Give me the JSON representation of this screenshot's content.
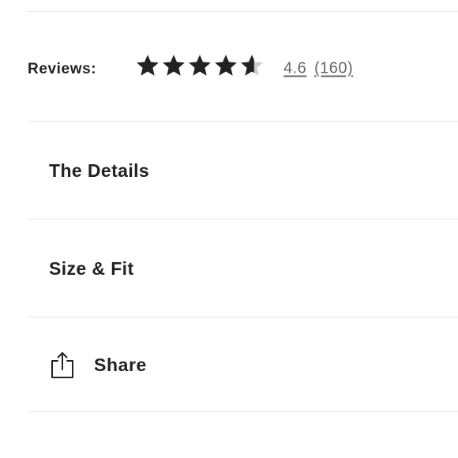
{
  "reviews": {
    "label": "Reviews:",
    "rating": "4.6",
    "rating_fraction_of_five": 0.92,
    "count": "(160)",
    "star_color": "#222222",
    "star_empty_color": "#cccccc"
  },
  "sections": {
    "details_label": "The Details",
    "size_fit_label": "Size & Fit",
    "share_label": "Share"
  },
  "icons": {
    "share": "share-icon",
    "star": "star-icon"
  }
}
